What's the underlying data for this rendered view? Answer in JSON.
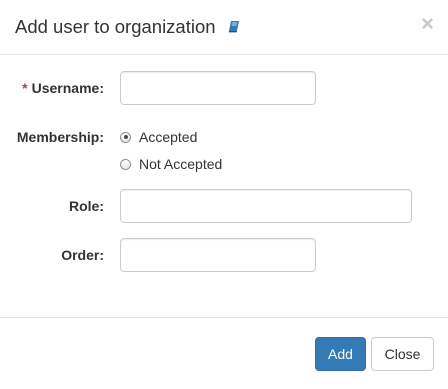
{
  "dialog": {
    "title": "Add user to organization",
    "help_icon": "book-icon",
    "close_symbol": "×"
  },
  "form": {
    "username": {
      "required_marker": "*",
      "label": "Username:",
      "value": "",
      "placeholder": ""
    },
    "membership": {
      "label": "Membership:",
      "options": [
        {
          "label": "Accepted",
          "checked": true
        },
        {
          "label": "Not Accepted",
          "checked": false
        }
      ]
    },
    "role": {
      "label": "Role:",
      "value": "",
      "placeholder": ""
    },
    "order": {
      "label": "Order:",
      "value": "",
      "placeholder": ""
    }
  },
  "footer": {
    "add_label": "Add",
    "close_label": "Close"
  },
  "colors": {
    "primary": "#337ab7",
    "required": "#a94442"
  }
}
